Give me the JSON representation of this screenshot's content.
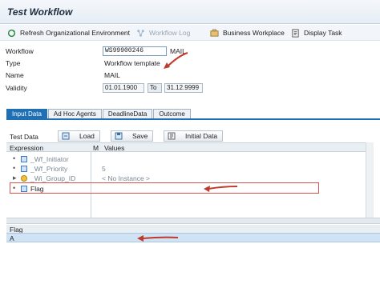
{
  "window": {
    "title": "Test Workflow"
  },
  "toolbar": {
    "refresh_label": "Refresh Organizational Environment",
    "workflow_log_label": "Workflow Log",
    "business_workplace_label": "Business Workplace",
    "display_task_label": "Display Task"
  },
  "form": {
    "workflow": {
      "label": "Workflow",
      "value": "WS99900246",
      "suffix": "MAIL"
    },
    "type": {
      "label": "Type",
      "value": "Workflow template"
    },
    "name": {
      "label": "Name",
      "value": "MAIL"
    },
    "validity": {
      "label": "Validity",
      "from": "01.01.1900",
      "to_label": "To",
      "to": "31.12.9999"
    }
  },
  "tabs": [
    {
      "label": "Input Data",
      "active": true
    },
    {
      "label": "Ad Hoc Agents",
      "active": false
    },
    {
      "label": "DeadlineData",
      "active": false
    },
    {
      "label": "Outcome",
      "active": false
    }
  ],
  "test_data": {
    "label": "Test Data",
    "load_label": "Load",
    "save_label": "Save",
    "initial_data_label": "Initial Data"
  },
  "tree": {
    "col_expression": "Expression",
    "col_m": "M",
    "col_values": "Values",
    "rows": [
      {
        "marker": "•",
        "expression": "_Wf_Initiator",
        "value": "",
        "icon": "container-element-icon"
      },
      {
        "marker": "•",
        "expression": "_Wf_Priority",
        "value": "5",
        "icon": "container-element-icon"
      },
      {
        "marker": "▸",
        "expression": "_Wi_Group_ID",
        "value": "< No Instance >",
        "icon": "object-instance-icon"
      },
      {
        "marker": "•",
        "expression": "Flag",
        "value": "",
        "icon": "container-element-icon"
      }
    ]
  },
  "detail": {
    "label": "Flag",
    "value": "A"
  },
  "colors": {
    "accent": "#1f6fb4",
    "highlight": "#d9534f",
    "selection": "#cfe3f5"
  }
}
